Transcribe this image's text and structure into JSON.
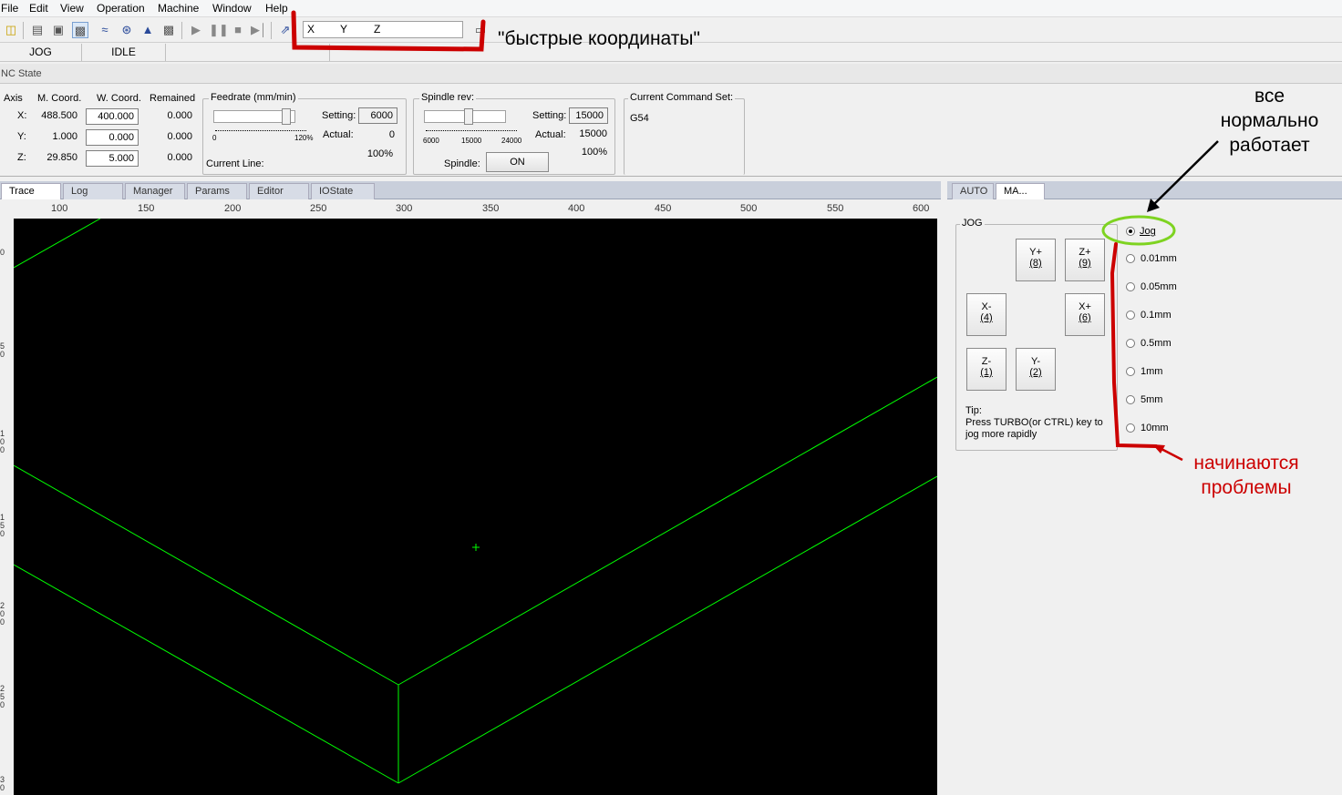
{
  "menu": [
    "File",
    "Edit",
    "View",
    "Operation",
    "Machine",
    "Window",
    "Help"
  ],
  "toolbar": {
    "icons": [
      "open-file-icon",
      "document-icon",
      "window-icon",
      "display-icon",
      "signal-icon",
      "antenna-icon",
      "tool-icon",
      "bin-icon",
      "play-icon",
      "pause-icon",
      "stop-icon",
      "step-icon",
      "arrows-icon"
    ],
    "quick_coords": {
      "x_label": "X",
      "y_label": "Y",
      "z_label": "Z"
    }
  },
  "status": {
    "mode": "JOG",
    "state": "IDLE"
  },
  "nc_state": {
    "title": "NC State",
    "headers": {
      "axis": "Axis",
      "m_coord": "M. Coord.",
      "w_coord": "W. Coord.",
      "remained": "Remained"
    },
    "axes": [
      {
        "name": "X:",
        "m": "488.500",
        "w": "400.000",
        "r": "0.000"
      },
      {
        "name": "Y:",
        "m": "1.000",
        "w": "0.000",
        "r": "0.000"
      },
      {
        "name": "Z:",
        "m": "29.850",
        "w": "5.000",
        "r": "0.000"
      }
    ],
    "feedrate": {
      "title": "Feedrate (mm/min)",
      "setting_label": "Setting:",
      "setting": "6000",
      "actual_label": "Actual:",
      "actual": "0",
      "percent": "100%",
      "scale_min": "0",
      "scale_max": "120%",
      "current_line_label": "Current Line:"
    },
    "spindle": {
      "title": "Spindle rev:",
      "setting_label": "Setting:",
      "setting": "15000",
      "actual_label": "Actual:",
      "actual": "15000",
      "percent": "100%",
      "ticks": [
        "6000",
        "15000",
        "24000"
      ],
      "spindle_label": "Spindle:",
      "button": "ON"
    },
    "command_set": {
      "title": "Current Command Set:",
      "value": "G54"
    }
  },
  "trace": {
    "tabs": [
      "Trace",
      "Log",
      "Manager",
      "Params",
      "Editor",
      "IOState"
    ],
    "active_tab": "Trace",
    "ruler_x": [
      "100",
      "150",
      "200",
      "250",
      "300",
      "350",
      "400",
      "450",
      "500",
      "550",
      "600"
    ],
    "ruler_y": [
      "0",
      "5 0",
      "1 0 0",
      "1 5 0",
      "2 0 0",
      "2 5 0",
      "3 0"
    ],
    "line_color": "#00ff00"
  },
  "manual": {
    "tabs": [
      "AUTO",
      "MA..."
    ],
    "active_tab": "MA...",
    "jog_title": "JOG",
    "buttons": [
      {
        "id": "y-plus",
        "label": "Y+",
        "key": "(8)"
      },
      {
        "id": "z-plus",
        "label": "Z+",
        "key": "(9)"
      },
      {
        "id": "x-minus",
        "label": "X-",
        "key": "(4)"
      },
      {
        "id": "x-plus",
        "label": "X+",
        "key": "(6)"
      },
      {
        "id": "z-minus",
        "label": "Z-",
        "key": "(1)"
      },
      {
        "id": "y-minus",
        "label": "Y-",
        "key": "(2)"
      }
    ],
    "tip_title": "Tip:",
    "tip_text": "Press TURBO(or CTRL) key to jog more rapidly",
    "step_options": [
      "Jog",
      "0.01mm",
      "0.05mm",
      "0.1mm",
      "0.5mm",
      "1mm",
      "5mm",
      "10mm"
    ],
    "selected_step": "Jog"
  },
  "annotations": {
    "quick_coords_note": "\"быстрые координаты\"",
    "ok_note": [
      "все",
      "нормально",
      "работает"
    ],
    "problem_note": [
      "начинаются",
      "проблемы"
    ],
    "red": "#cc0000",
    "green": "#7ed321"
  }
}
